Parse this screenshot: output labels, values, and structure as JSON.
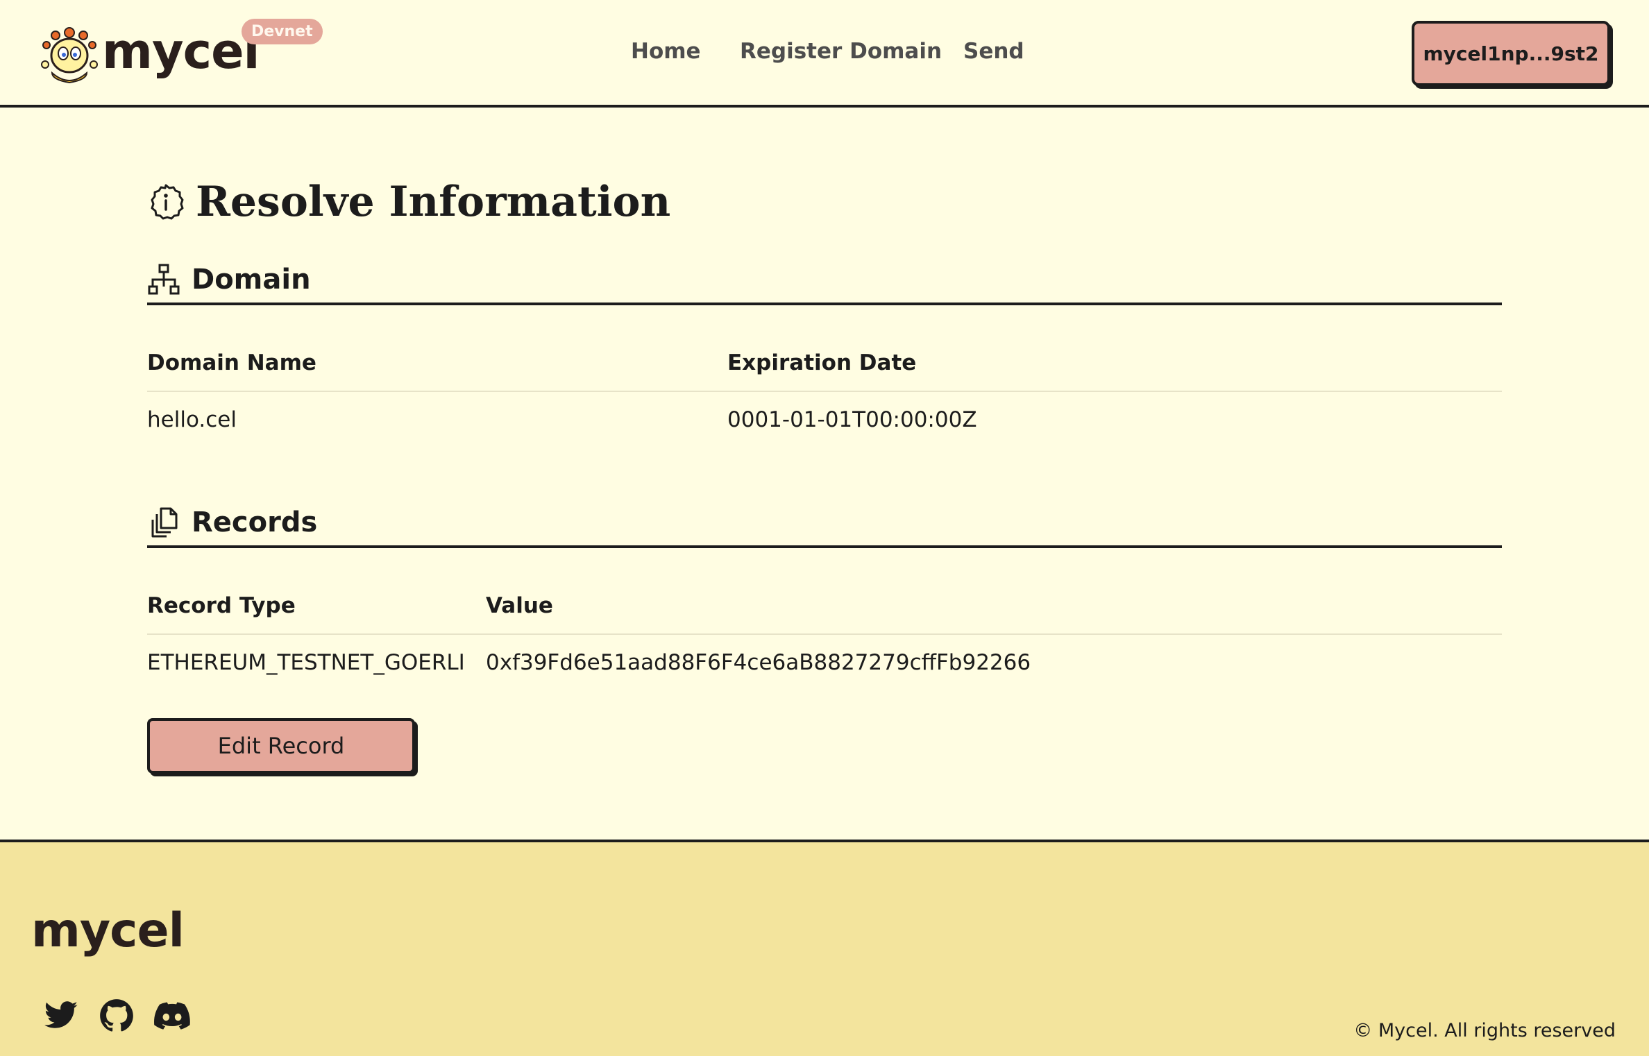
{
  "header": {
    "logo_text": "mycel",
    "badge": "Devnet",
    "nav": [
      {
        "label": "Home"
      },
      {
        "label": "Register Domain"
      },
      {
        "label": "Send"
      }
    ],
    "wallet_label": "mycel1np...9st2"
  },
  "page": {
    "title": "Resolve Information"
  },
  "domain_section": {
    "heading": "Domain",
    "columns": [
      "Domain Name",
      "Expiration Date"
    ],
    "row": {
      "domain_name": "hello.cel",
      "expiration_date": "0001-01-01T00:00:00Z"
    }
  },
  "records_section": {
    "heading": "Records",
    "columns": [
      "Record Type",
      "Value"
    ],
    "rows": [
      {
        "type": "ETHEREUM_TESTNET_GOERLI",
        "value": "0xf39Fd6e51aad88F6F4ce6aB8827279cffFb92266"
      }
    ],
    "edit_button": "Edit Record"
  },
  "footer": {
    "logo_text": "mycel",
    "social": [
      "twitter-icon",
      "github-icon",
      "discord-icon"
    ],
    "copyright": "© Mycel. All rights reserved"
  },
  "colors": {
    "background": "#fffde2",
    "accent": "#e4a79a",
    "footer_bg": "#f3e49d",
    "ink": "#1c1c1c"
  }
}
